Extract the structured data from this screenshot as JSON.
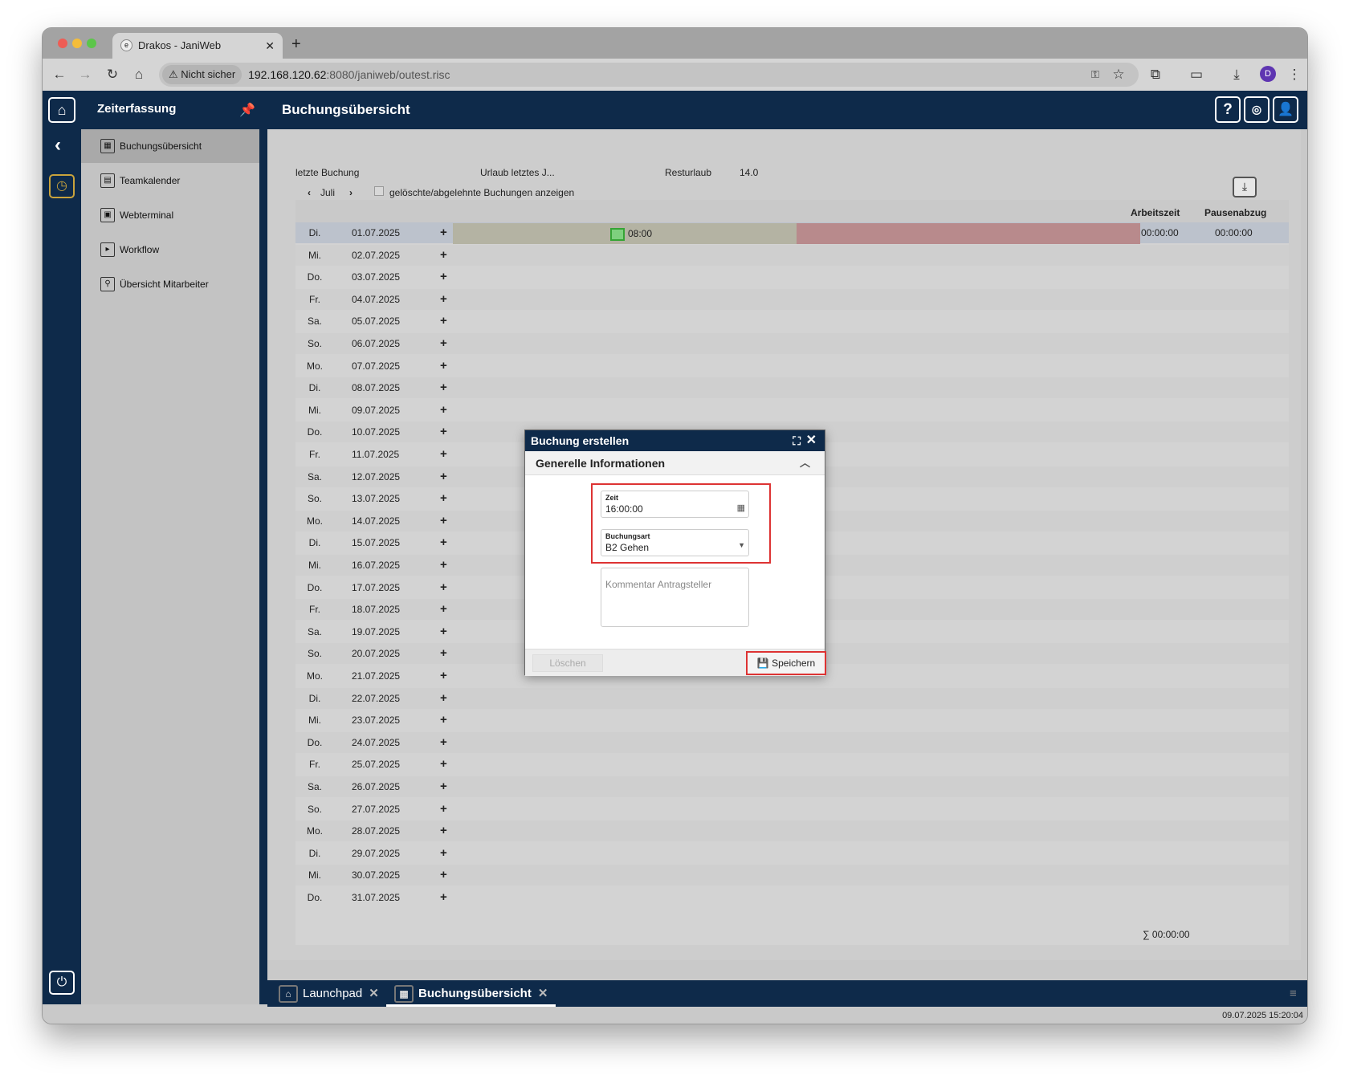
{
  "browser": {
    "tab_title": "Drakos - JaniWeb",
    "security": "Nicht sicher",
    "url_host": "192.168.120.62",
    "url_rest": ":8080/janiweb/outest.risc",
    "avatar": "D"
  },
  "app": {
    "module_title": "Zeiterfassung",
    "page_title": "Buchungsübersicht"
  },
  "sidebar": {
    "items": [
      {
        "label": "Buchungsübersicht"
      },
      {
        "label": "Teamkalender"
      },
      {
        "label": "Webterminal"
      },
      {
        "label": "Workflow"
      },
      {
        "label": "Übersicht Mitarbeiter"
      }
    ]
  },
  "info": {
    "last_booking_label": "letzte Buchung",
    "vacation_label": "Urlaub letztes J...",
    "rest_label": "Resturlaub",
    "rest_value": "14.0",
    "month": "Juli",
    "show_deleted": "gelöschte/abgelehnte Buchungen anzeigen"
  },
  "table": {
    "col_work": "Arbeitszeit",
    "col_break": "Pausenabzug",
    "first_time": "08:00",
    "first_work": "00:00:00",
    "first_break": "00:00:00",
    "sum": "∑  00:00:00",
    "rows": [
      {
        "d": "Di.",
        "date": "01.07.2025"
      },
      {
        "d": "Mi.",
        "date": "02.07.2025"
      },
      {
        "d": "Do.",
        "date": "03.07.2025"
      },
      {
        "d": "Fr.",
        "date": "04.07.2025"
      },
      {
        "d": "Sa.",
        "date": "05.07.2025"
      },
      {
        "d": "So.",
        "date": "06.07.2025"
      },
      {
        "d": "Mo.",
        "date": "07.07.2025"
      },
      {
        "d": "Di.",
        "date": "08.07.2025"
      },
      {
        "d": "Mi.",
        "date": "09.07.2025"
      },
      {
        "d": "Do.",
        "date": "10.07.2025"
      },
      {
        "d": "Fr.",
        "date": "11.07.2025"
      },
      {
        "d": "Sa.",
        "date": "12.07.2025"
      },
      {
        "d": "So.",
        "date": "13.07.2025"
      },
      {
        "d": "Mo.",
        "date": "14.07.2025"
      },
      {
        "d": "Di.",
        "date": "15.07.2025"
      },
      {
        "d": "Mi.",
        "date": "16.07.2025"
      },
      {
        "d": "Do.",
        "date": "17.07.2025"
      },
      {
        "d": "Fr.",
        "date": "18.07.2025"
      },
      {
        "d": "Sa.",
        "date": "19.07.2025"
      },
      {
        "d": "So.",
        "date": "20.07.2025"
      },
      {
        "d": "Mo.",
        "date": "21.07.2025"
      },
      {
        "d": "Di.",
        "date": "22.07.2025"
      },
      {
        "d": "Mi.",
        "date": "23.07.2025"
      },
      {
        "d": "Do.",
        "date": "24.07.2025"
      },
      {
        "d": "Fr.",
        "date": "25.07.2025"
      },
      {
        "d": "Sa.",
        "date": "26.07.2025"
      },
      {
        "d": "So.",
        "date": "27.07.2025"
      },
      {
        "d": "Mo.",
        "date": "28.07.2025"
      },
      {
        "d": "Di.",
        "date": "29.07.2025"
      },
      {
        "d": "Mi.",
        "date": "30.07.2025"
      },
      {
        "d": "Do.",
        "date": "31.07.2025"
      }
    ]
  },
  "dialog": {
    "title": "Buchung erstellen",
    "section": "Generelle Informationen",
    "time_label": "Zeit",
    "time_value": "16:00:00",
    "type_label": "Buchungsart",
    "type_value": "B2 Gehen",
    "comment_placeholder": "Kommentar Antragsteller",
    "delete": "Löschen",
    "save": "Speichern"
  },
  "bottom_tabs": [
    {
      "label": "Launchpad"
    },
    {
      "label": "Buchungsübersicht"
    }
  ],
  "status": {
    "datetime": "09.07.2025 15:20:04"
  }
}
